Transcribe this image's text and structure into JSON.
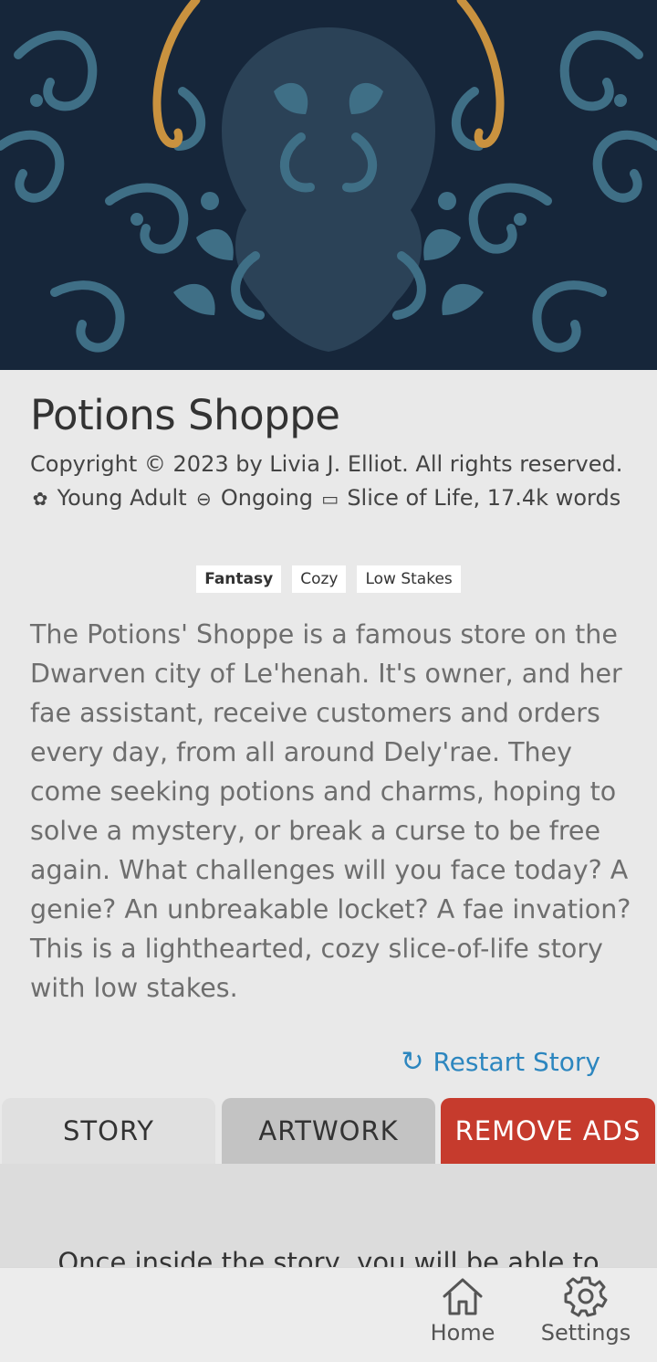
{
  "book": {
    "title": "Potions Shoppe",
    "copyright": "Copyright © 2023 by Livia J. Elliot. All rights reserved.",
    "audience": "Young Adult",
    "status": "Ongoing",
    "genre_words": "Slice of Life, 17.4k words",
    "tags": [
      "Fantasy",
      "Cozy",
      "Low Stakes"
    ],
    "description": "The Potions' Shoppe is a famous store on the Dwarven city of Le'henah. It's owner, and her fae assistant, receive customers and orders every day, from all around  Dely'rae. They come seeking potions and charms, hoping to solve a mystery, or break a curse to be free again. What challenges will you face today? A genie? An unbreakable locket? A fae invation? This is a lighthearted, cozy slice-of-life story with low stakes."
  },
  "actions": {
    "restart_label": "Restart Story"
  },
  "tabs": {
    "story": "STORY",
    "artwork": "ARTWORK",
    "remove_ads": "REMOVE ADS"
  },
  "panel": {
    "text": "Once inside the story, you will be able to"
  },
  "nav": {
    "home": "Home",
    "settings": "Settings"
  },
  "colors": {
    "cover_bg": "#16263a",
    "swirl": "#3f6f86",
    "gold": "#c9923f",
    "accent_link": "#2c86bf",
    "ads_red": "#c63b2d"
  }
}
